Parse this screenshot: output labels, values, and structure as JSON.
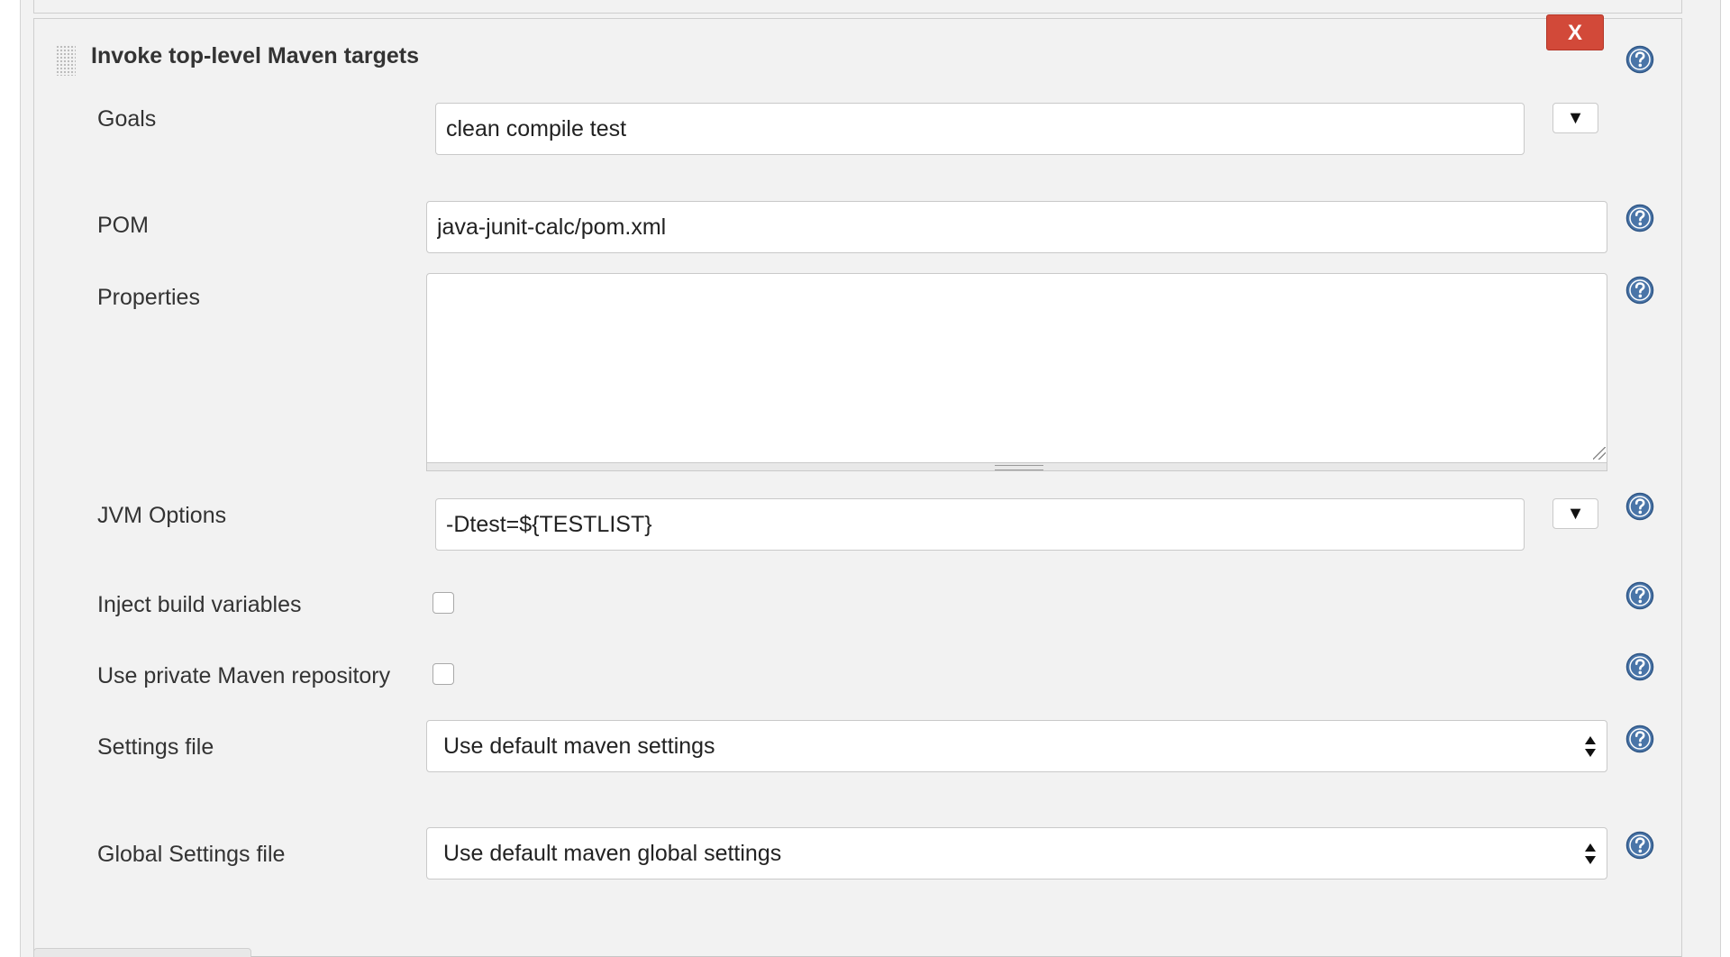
{
  "section": {
    "title": "Invoke top-level Maven targets",
    "delete_label": "X"
  },
  "fields": {
    "goals": {
      "label": "Goals",
      "value": "clean compile test",
      "dropdown_glyph": "▼"
    },
    "pom": {
      "label": "POM",
      "value": "java-junit-calc/pom.xml"
    },
    "properties": {
      "label": "Properties",
      "value": ""
    },
    "jvm_options": {
      "label": "JVM Options",
      "value": "-Dtest=${TESTLIST}",
      "dropdown_glyph": "▼"
    },
    "inject_build_variables": {
      "label": "Inject build variables",
      "checked": false
    },
    "use_private_repo": {
      "label": "Use private Maven repository",
      "checked": false
    },
    "settings_file": {
      "label": "Settings file",
      "selected": "Use default maven settings"
    },
    "global_settings_file": {
      "label": "Global Settings file",
      "selected": "Use default maven global settings"
    }
  },
  "icons": {
    "help": "help-question-icon",
    "drag": "drag-handle-icon",
    "dropdown": "triangle-down-icon",
    "select_arrows": "up-down-arrows-icon"
  },
  "colors": {
    "panel_bg": "#f2f2f2",
    "delete_button": "#d24939",
    "help_icon": "#4a75a8"
  }
}
